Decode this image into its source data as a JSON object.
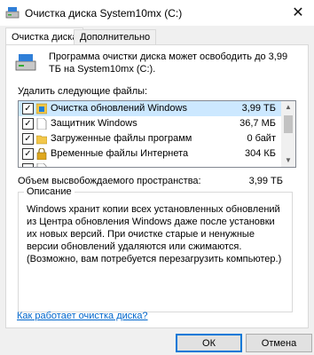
{
  "window": {
    "title": "Очистка диска System10mx (C:)",
    "close_glyph": "✕"
  },
  "tabs": [
    {
      "label": "Очистка диска",
      "active": true
    },
    {
      "label": "Дополнительно",
      "active": false
    }
  ],
  "intro": {
    "text": "Программа очистки диска может освободить до 3,99 ТБ на System10mx (C:).",
    "icon": "disk-cleanup-icon"
  },
  "files_label": "Удалить следующие файлы:",
  "files": [
    {
      "name": "Очистка обновлений Windows",
      "size": "3,99 ТБ",
      "checked": true,
      "icon": "windows-update-icon",
      "selected": true
    },
    {
      "name": "Защитник Windows",
      "size": "36,7 МБ",
      "checked": true,
      "icon": "file-icon",
      "selected": false
    },
    {
      "name": "Загруженные файлы программ",
      "size": "0 байт",
      "checked": true,
      "icon": "folder-icon",
      "selected": false
    },
    {
      "name": "Временные файлы Интернета",
      "size": "304 КБ",
      "checked": true,
      "icon": "lock-icon",
      "selected": false
    },
    {
      "name": "",
      "size": "",
      "checked": false,
      "icon": "file-icon",
      "selected": false
    }
  ],
  "space_label": "Объем высвобождаемого пространства:",
  "space_value": "3,99 ТБ",
  "description": {
    "title": "Описание",
    "text": "Windows хранит копии всех установленных обновлений из Центра обновления Windows даже после установки их новых версий. При очистке старые и ненужные версии обновлений удаляются или сжимаются. (Возможно, вам потребуется перезагрузить компьютер.)"
  },
  "help_link": "Как работает очистка диска?",
  "buttons": {
    "ok": "ОК",
    "cancel": "Отмена"
  },
  "colors": {
    "selection": "#cce8ff",
    "link": "#0066cc",
    "accent": "#0078d7"
  }
}
